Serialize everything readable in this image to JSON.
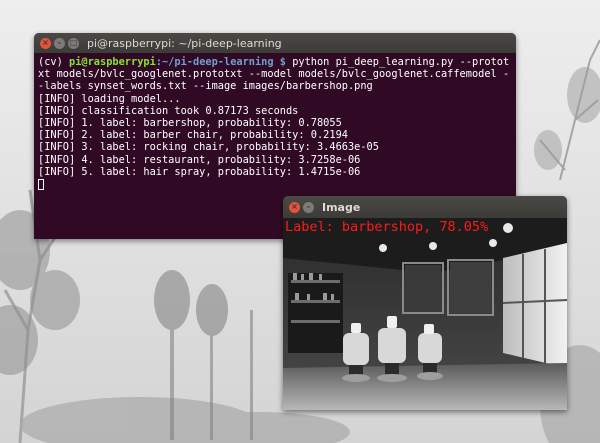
{
  "terminal": {
    "title": "pi@raspberrypi: ~/pi-deep-learning",
    "prompt_env": "(cv) ",
    "prompt_user": "pi@raspberrypi",
    "prompt_path": ":~/pi-deep-learning $ ",
    "command": "python pi_deep_learning.py --prototxt models/bvlc_googlenet.prototxt --model models/bvlc_googlenet.caffemodel --labels synset_words.txt --image images/barbershop.png",
    "output_lines": [
      "[INFO] loading model...",
      "[INFO] classification took 0.87173 seconds",
      "[INFO] 1. label: barbershop, probability: 0.78055",
      "[INFO] 2. label: barber chair, probability: 0.2194",
      "[INFO] 3. label: rocking chair, probability: 3.4663e-05",
      "[INFO] 4. label: restaurant, probability: 3.7258e-06",
      "[INFO] 5. label: hair spray, probability: 1.4715e-06"
    ]
  },
  "image_window": {
    "title": "Image",
    "overlay_label": "Label: barbershop, 78.05%"
  },
  "window_buttons": {
    "close_glyph": "×",
    "minimize_glyph": "–",
    "maximize_glyph": "□"
  },
  "colors": {
    "terminal_bg": "#300a24",
    "titlebar": "#3c3b37",
    "prompt_user": "#8ae234",
    "prompt_path": "#729fcf",
    "label_red": "#ff1a1a"
  }
}
